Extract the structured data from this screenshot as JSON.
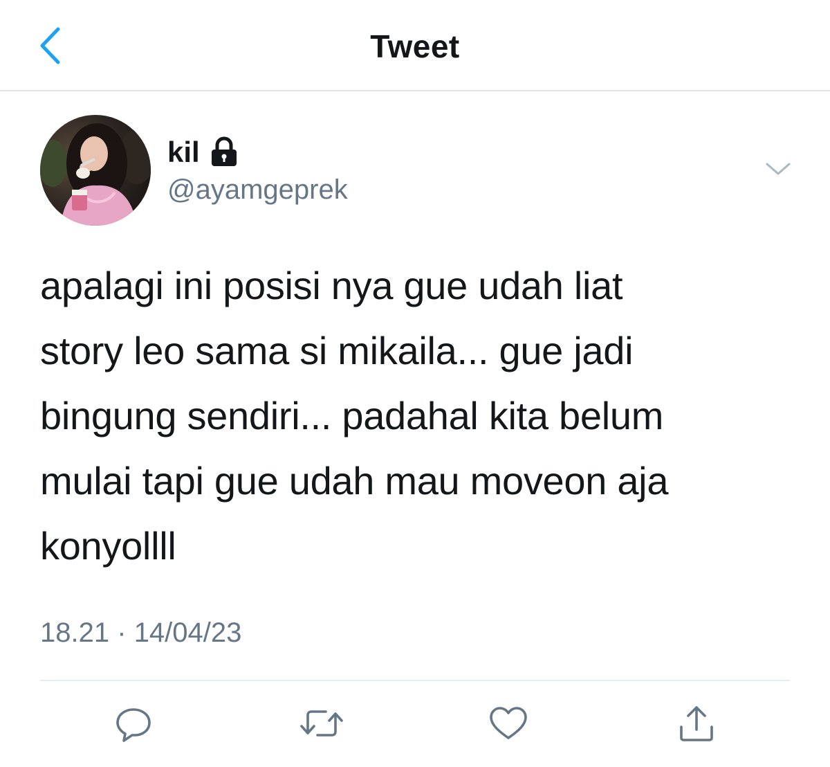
{
  "header": {
    "title": "Tweet",
    "back_icon": "chevron-left-icon"
  },
  "author": {
    "display_name": "kil",
    "handle": "@ayamgeprek",
    "protected_icon": "lock-icon",
    "avatar_icon": "avatar"
  },
  "tweet": {
    "text": "apalagi ini posisi nya gue udah liat\nstory leo sama si mikaila... gue jadi\nbingung sendiri... padahal kita belum\nmulai tapi gue udah mau moveon aja\nkonyollll",
    "time": "18.21",
    "separator": "·",
    "date": "14/04/23"
  },
  "actions": [
    {
      "name": "reply",
      "icon": "reply-icon"
    },
    {
      "name": "retweet",
      "icon": "retweet-icon"
    },
    {
      "name": "like",
      "icon": "heart-icon"
    },
    {
      "name": "share",
      "icon": "share-icon"
    }
  ],
  "colors": {
    "accent": "#1da1f2",
    "secondary_text": "#657786",
    "icon_gray": "#657786",
    "divider": "#e6ecf0"
  }
}
